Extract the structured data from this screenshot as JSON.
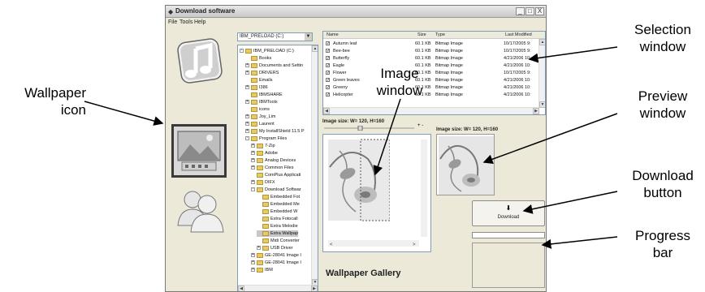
{
  "window": {
    "title": "Download software",
    "controls": [
      "_",
      "□",
      "X"
    ]
  },
  "menu": [
    "File",
    "Tools",
    "Help"
  ],
  "categories": [
    {
      "icon": "music-note-icon"
    },
    {
      "icon": "wallpaper-icon",
      "selected": true
    },
    {
      "icon": "contacts-icon"
    }
  ],
  "tree": {
    "drive": "IBM_PRELOAD (C:)",
    "items": [
      {
        "label": "IBM_PRELOAD (C:)",
        "indent": 0,
        "exp": "-"
      },
      {
        "label": "Books",
        "indent": 1,
        "exp": ""
      },
      {
        "label": "Documents and Settin",
        "indent": 1,
        "exp": "+"
      },
      {
        "label": "DRIVERS",
        "indent": 1,
        "exp": "+"
      },
      {
        "label": "Emails",
        "indent": 1,
        "exp": ""
      },
      {
        "label": "I386",
        "indent": 1,
        "exp": "+"
      },
      {
        "label": "IBMSHARE",
        "indent": 1,
        "exp": ""
      },
      {
        "label": "IBMTools",
        "indent": 1,
        "exp": "+"
      },
      {
        "label": "icons",
        "indent": 1,
        "exp": ""
      },
      {
        "label": "Joy_Lim",
        "indent": 1,
        "exp": "+"
      },
      {
        "label": "Laurent",
        "indent": 1,
        "exp": "+"
      },
      {
        "label": "My InstallShield 11.5 P",
        "indent": 1,
        "exp": "+"
      },
      {
        "label": "Program Files",
        "indent": 1,
        "exp": "-"
      },
      {
        "label": "7-Zip",
        "indent": 2,
        "exp": "+"
      },
      {
        "label": "Adobe",
        "indent": 2,
        "exp": "+"
      },
      {
        "label": "Analog Devices",
        "indent": 2,
        "exp": "+"
      },
      {
        "label": "Common Files",
        "indent": 2,
        "exp": "+"
      },
      {
        "label": "ComPlus Applicati",
        "indent": 2,
        "exp": ""
      },
      {
        "label": "DIFX",
        "indent": 2,
        "exp": "+"
      },
      {
        "label": "Download Softwar",
        "indent": 2,
        "exp": "-"
      },
      {
        "label": "Embedded Fot",
        "indent": 3,
        "exp": ""
      },
      {
        "label": "Embedded Me",
        "indent": 3,
        "exp": ""
      },
      {
        "label": "Embedded W",
        "indent": 3,
        "exp": ""
      },
      {
        "label": "Extra Fotocall",
        "indent": 3,
        "exp": ""
      },
      {
        "label": "Extra Melodie",
        "indent": 3,
        "exp": ""
      },
      {
        "label": "Extra Wallpap",
        "indent": 3,
        "exp": "",
        "selected": true
      },
      {
        "label": "Midi Converter",
        "indent": 3,
        "exp": ""
      },
      {
        "label": "USB Driver",
        "indent": 3,
        "exp": "+"
      },
      {
        "label": "GE-28041 Image I",
        "indent": 2,
        "exp": "+"
      },
      {
        "label": "GE-28041 Image I",
        "indent": 2,
        "exp": "+"
      },
      {
        "label": "IBM",
        "indent": 2,
        "exp": "+"
      }
    ]
  },
  "filelist": {
    "headers": {
      "name": "Name",
      "size": "Size",
      "type": "Type",
      "modified": "Last Modified"
    },
    "rows": [
      {
        "name": "Autumn leaf",
        "size": "60.1 KB",
        "type": "Bitmap Image",
        "modified": "10/17/2005 9:"
      },
      {
        "name": "Bee-bee",
        "size": "60.1 KB",
        "type": "Bitmap Image",
        "modified": "10/17/2005 9:"
      },
      {
        "name": "Butterfly",
        "size": "60.1 KB",
        "type": "Bitmap Image",
        "modified": "4/21/2006 10:"
      },
      {
        "name": "Eagle",
        "size": "60.1 KB",
        "type": "Bitmap Image",
        "modified": "4/21/2006 10:"
      },
      {
        "name": "Flower",
        "size": "60.1 KB",
        "type": "Bitmap Image",
        "modified": "10/17/2005 9:"
      },
      {
        "name": "Green leaves",
        "size": "60.1 KB",
        "type": "Bitmap Image",
        "modified": "4/21/2006 10:"
      },
      {
        "name": "Greeny",
        "size": "60.1 KB",
        "type": "Bitmap Image",
        "modified": "4/21/2006 10:"
      },
      {
        "name": "Helicopter",
        "size": "60.1 KB",
        "type": "Bitmap Image",
        "modified": "4/21/2006 10:"
      }
    ]
  },
  "image_window": {
    "size_label": "Image size: W= 120, H=160",
    "zoom_plus": "+",
    "zoom_minus": "-"
  },
  "preview_window": {
    "size_label": "Image size: W= 120, H=160"
  },
  "download": {
    "label": "Download",
    "arrow": "⬇"
  },
  "progress": {
    "value": 0
  },
  "gallery": {
    "title": "Wallpaper Gallery"
  },
  "annotations": {
    "selection_window": "Selection\nwindow",
    "image_window": "Image\nwindow",
    "preview_window": "Preview\nwindow",
    "download_button": "Download\nbutton",
    "progress_bar": "Progress\nbar",
    "wallpaper_icon": "Wallpaper\nicon"
  },
  "colors": {
    "window_bg": "#ece9d8",
    "list_border": "#7f9db9",
    "folder": "#e8c96a",
    "selected_row": "#c8c8c8"
  }
}
